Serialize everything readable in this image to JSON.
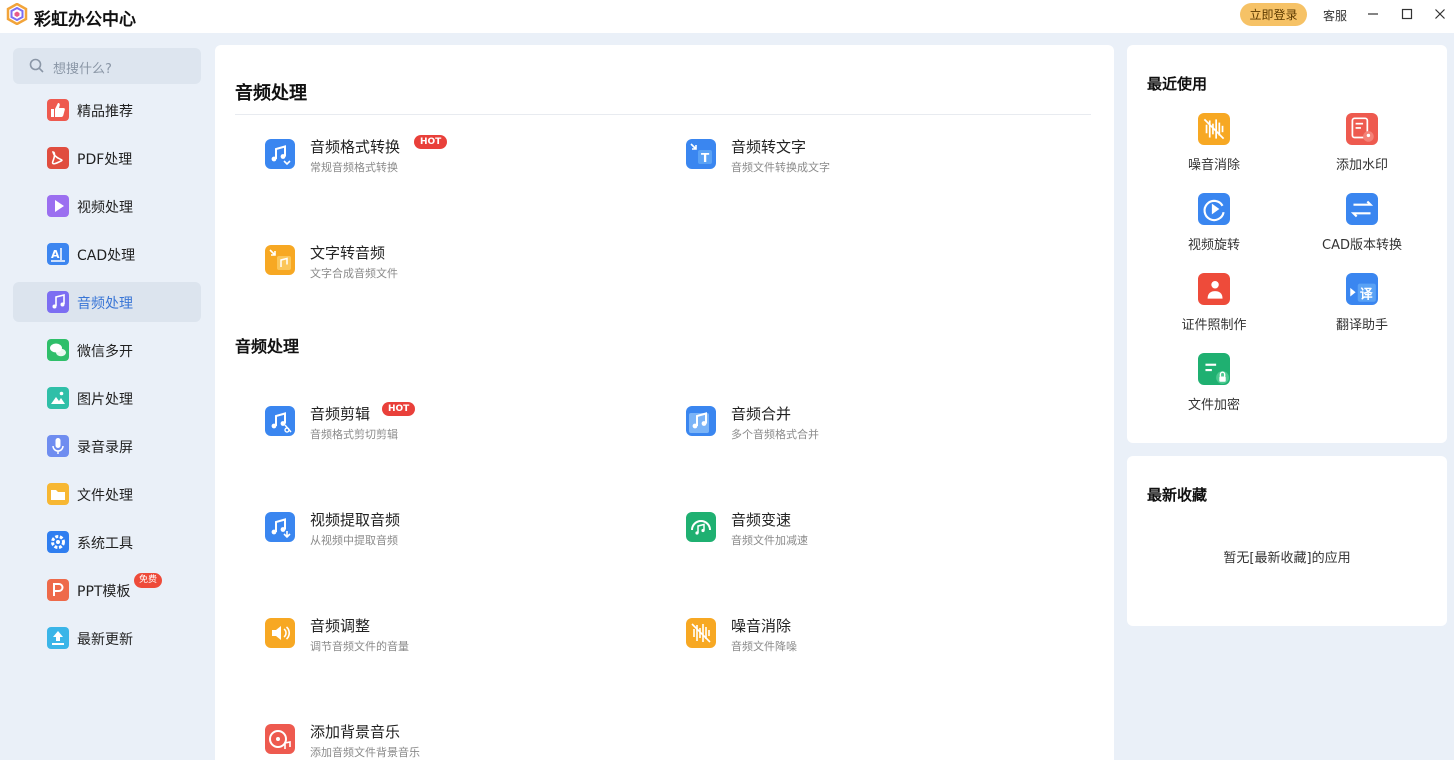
{
  "app": {
    "title": "彩虹办公中心",
    "login_label": "立即登录",
    "service_label": "客服"
  },
  "search": {
    "placeholder": "想搜什么?"
  },
  "sidebar": {
    "items": [
      {
        "label": "精品推荐",
        "icon": "thumbs-up-icon",
        "color": "#ee5a4f"
      },
      {
        "label": "PDF处理",
        "icon": "pdf-icon",
        "color": "#e04d3f"
      },
      {
        "label": "视频处理",
        "icon": "play-icon",
        "color": "#9b6ff0"
      },
      {
        "label": "CAD处理",
        "icon": "cad-icon",
        "color": "#3d86f0"
      },
      {
        "label": "音频处理",
        "icon": "music-note-icon",
        "color": "#7c6ef2",
        "active": true
      },
      {
        "label": "微信多开",
        "icon": "wechat-icon",
        "color": "#2fbf6a"
      },
      {
        "label": "图片处理",
        "icon": "image-icon",
        "color": "#2fbfa8"
      },
      {
        "label": "录音录屏",
        "icon": "microphone-icon",
        "color": "#6f8df0"
      },
      {
        "label": "文件处理",
        "icon": "folder-icon",
        "color": "#f7b733"
      },
      {
        "label": "系统工具",
        "icon": "gear-icon",
        "color": "#2f7ef0"
      },
      {
        "label": "PPT模板",
        "icon": "ppt-icon",
        "color": "#ee6a4a",
        "badge": "免费"
      },
      {
        "label": "最新更新",
        "icon": "upload-icon",
        "color": "#3ab5e8"
      }
    ]
  },
  "main": {
    "sections": [
      {
        "title": "音频处理",
        "tools": [
          {
            "name": "音频格式转换",
            "desc": "常规音频格式转换",
            "badge": "HOT",
            "icon": "audio-convert-icon",
            "color": "#3a86f0"
          },
          {
            "name": "音频转文字",
            "desc": "音频文件转换成文字",
            "icon": "audio-to-text-icon",
            "color": "#3a86f0"
          },
          {
            "name": "文字转音频",
            "desc": "文字合成音频文件",
            "icon": "text-to-audio-icon",
            "color": "#f7a823"
          }
        ]
      },
      {
        "title": "音频处理",
        "tools": [
          {
            "name": "音频剪辑",
            "desc": "音频格式剪切剪辑",
            "badge": "HOT",
            "icon": "audio-cut-icon",
            "color": "#3a86f0"
          },
          {
            "name": "音频合并",
            "desc": "多个音频格式合并",
            "icon": "audio-merge-icon",
            "color": "#3a86f0"
          },
          {
            "name": "视频提取音频",
            "desc": "从视频中提取音频",
            "icon": "video-extract-audio-icon",
            "color": "#3a86f0"
          },
          {
            "name": "音频变速",
            "desc": "音频文件加减速",
            "icon": "audio-speed-icon",
            "color": "#1fb071"
          },
          {
            "name": "音频调整",
            "desc": "调节音频文件的音量",
            "icon": "volume-icon",
            "color": "#f7a823"
          },
          {
            "name": "噪音消除",
            "desc": "音频文件降噪",
            "icon": "noise-removal-icon",
            "color": "#f7a823"
          },
          {
            "name": "添加背景音乐",
            "desc": "添加音频文件背景音乐",
            "icon": "background-music-icon",
            "color": "#ee5a4f"
          }
        ]
      }
    ]
  },
  "recent": {
    "title": "最近使用",
    "items": [
      {
        "label": "噪音消除",
        "icon": "noise-removal-icon",
        "color": "#f7a823"
      },
      {
        "label": "添加水印",
        "icon": "watermark-icon",
        "color": "#ee5a4f"
      },
      {
        "label": "视频旋转",
        "icon": "video-rotate-icon",
        "color": "#3a86f0"
      },
      {
        "label": "CAD版本转换",
        "icon": "cad-convert-icon",
        "color": "#3a86f0"
      },
      {
        "label": "证件照制作",
        "icon": "id-photo-icon",
        "color": "#ee4b3a"
      },
      {
        "label": "翻译助手",
        "icon": "translate-icon",
        "color": "#3a86f0"
      },
      {
        "label": "文件加密",
        "icon": "file-lock-icon",
        "color": "#1fb071"
      }
    ]
  },
  "favorites": {
    "title": "最新收藏",
    "empty_text": "暂无[最新收藏]的应用"
  }
}
